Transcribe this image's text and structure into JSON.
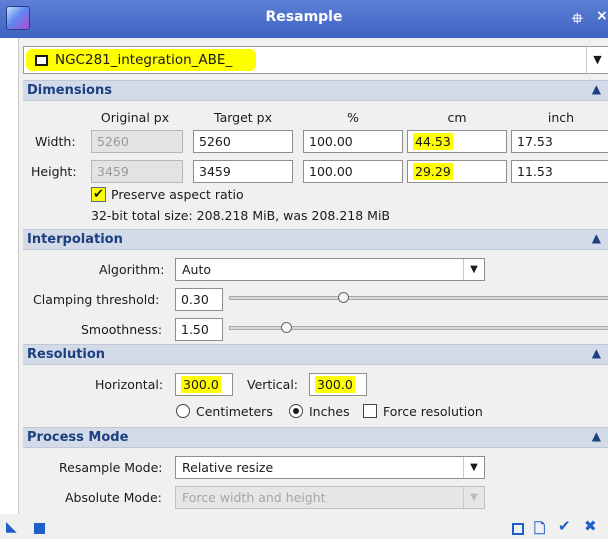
{
  "window": {
    "title": "Resample"
  },
  "view": {
    "name": "NGC281_integration_ABE_"
  },
  "dimensions": {
    "header": "Dimensions",
    "col_original": "Original px",
    "col_target": "Target px",
    "col_percent": "%",
    "col_cm": "cm",
    "col_inch": "inch",
    "width_label": "Width:",
    "height_label": "Height:",
    "width": {
      "original": "5260",
      "target": "5260",
      "percent": "100.00",
      "cm": "44.53",
      "inch": "17.53"
    },
    "height": {
      "original": "3459",
      "target": "3459",
      "percent": "100.00",
      "cm": "29.29",
      "inch": "11.53"
    },
    "preserve_label": "Preserve aspect ratio",
    "size_text": "32-bit total size: 208.218 MiB, was 208.218 MiB"
  },
  "interpolation": {
    "header": "Interpolation",
    "algorithm_label": "Algorithm:",
    "algorithm_value": "Auto",
    "clamping_label": "Clamping threshold:",
    "clamping_value": "0.30",
    "clamping_fraction": 0.3,
    "smoothness_label": "Smoothness:",
    "smoothness_value": "1.50",
    "smoothness_fraction": 0.15
  },
  "resolution": {
    "header": "Resolution",
    "horizontal_label": "Horizontal:",
    "horizontal_value": "300.0",
    "vertical_label": "Vertical:",
    "vertical_value": "300.0",
    "centimeters_label": "Centimeters",
    "inches_label": "Inches",
    "force_label": "Force resolution"
  },
  "process_mode": {
    "header": "Process Mode",
    "resample_mode_label": "Resample Mode:",
    "resample_mode_value": "Relative resize",
    "absolute_mode_label": "Absolute Mode:",
    "absolute_mode_value": "Force width and height"
  },
  "colors": {
    "highlight": "#ffff00",
    "titlebar": "#4a6cc9",
    "section_text": "#1c3f7f",
    "toolbar_icon": "#1f5fc8"
  }
}
